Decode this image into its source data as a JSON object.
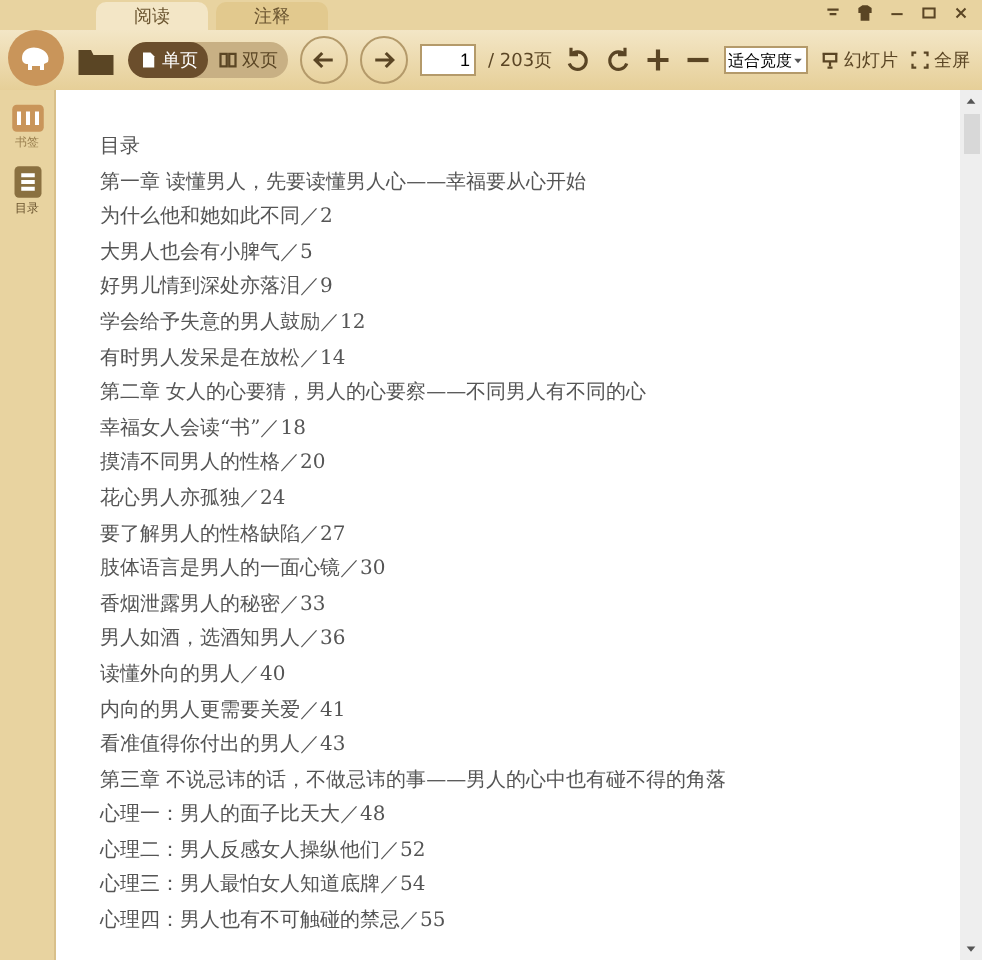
{
  "tabs": [
    {
      "label": "阅读",
      "selected": true
    },
    {
      "label": "注释",
      "selected": false
    }
  ],
  "toolbar": {
    "view_modes": [
      {
        "label": "单页",
        "selected": true
      },
      {
        "label": "双页",
        "selected": false
      }
    ],
    "page_input": {
      "value": "1"
    },
    "page_total": "/ 203页",
    "zoom_select": {
      "value": "适合宽度"
    },
    "slideshow": "幻灯片",
    "fullscreen": "全屏"
  },
  "sidebar": {
    "items": [
      {
        "label": "书签",
        "kind": "bookmark",
        "selected": false
      },
      {
        "label": "目录",
        "kind": "toc",
        "selected": true
      }
    ]
  },
  "document": {
    "lines": [
      "目录",
      "第一章  读懂男人，先要读懂男人心——幸福要从心开始",
      "为什么他和她如此不同／2",
      "大男人也会有小脾气／5",
      "好男儿情到深处亦落泪／9",
      "学会给予失意的男人鼓励／12",
      "有时男人发呆是在放松／14",
      "第二章  女人的心要猜，男人的心要察——不同男人有不同的心",
      "幸福女人会读“书”／18",
      "摸清不同男人的性格／20",
      "花心男人亦孤独／24",
      "要了解男人的性格缺陷／27",
      "肢体语言是男人的一面心镜／30",
      "香烟泄露男人的秘密／33",
      "男人如酒，选酒知男人／36",
      "读懂外向的男人／40",
      "内向的男人更需要关爱／41",
      "看准值得你付出的男人／43",
      "第三章  不说忌讳的话，不做忌讳的事——男人的心中也有碰不得的角落",
      "心理一：男人的面子比天大／48",
      "心理二：男人反感女人操纵他们／52",
      "心理三：男人最怕女人知道底牌／54",
      "心理四：男人也有不可触碰的禁忌／55"
    ]
  }
}
